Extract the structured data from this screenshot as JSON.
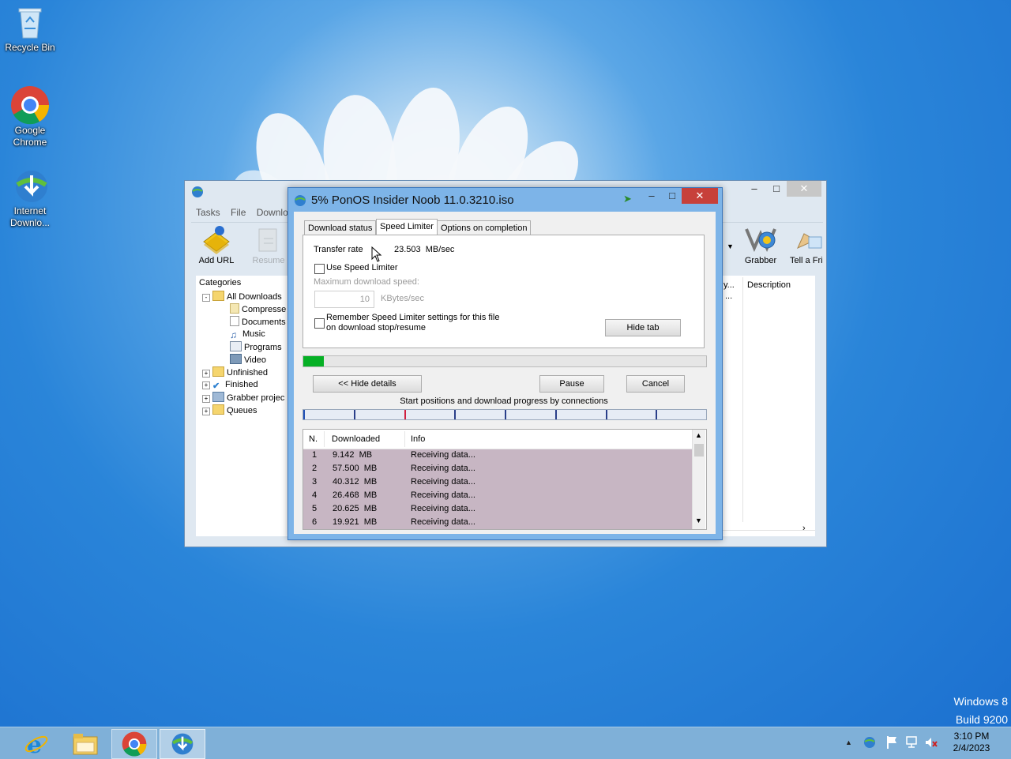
{
  "desktop": {
    "icons": [
      {
        "label": "Recycle Bin",
        "icon": "recycle-bin-icon"
      },
      {
        "label": "Google Chrome",
        "icon": "chrome-icon"
      },
      {
        "label": "Internet Downlo...",
        "icon": "idm-icon"
      }
    ],
    "watermark": {
      "line1": "Windows 8",
      "line2": "Build 9200"
    }
  },
  "main_window": {
    "menu": [
      "Tasks",
      "File",
      "Downlo"
    ],
    "toolbar": {
      "add_url": "Add URL",
      "resume": "Resume",
      "grabber": "Grabber",
      "tell_a_friend": "Tell a Fri"
    },
    "categories_label": "Categories",
    "tree": [
      {
        "label": "All Downloads",
        "icon": "folder-open-icon"
      },
      {
        "label": "Compresse",
        "icon": "zip-icon"
      },
      {
        "label": "Documents",
        "icon": "document-icon"
      },
      {
        "label": "Music",
        "icon": "music-icon"
      },
      {
        "label": "Programs",
        "icon": "program-icon"
      },
      {
        "label": "Video",
        "icon": "video-icon"
      },
      {
        "label": "Unfinished",
        "icon": "folder-arrow-icon"
      },
      {
        "label": "Finished",
        "icon": "folder-check-icon"
      },
      {
        "label": "Grabber projec",
        "icon": "grabber-folder-icon"
      },
      {
        "label": "Queues",
        "icon": "folder-icon"
      }
    ],
    "list_columns": {
      "col_partial": "y...",
      "description": "Description"
    },
    "list_cell": "..."
  },
  "dialog": {
    "title": "5% PonOS Insider Noob 11.0.3210.iso",
    "tabs": [
      "Download status",
      "Speed Limiter",
      "Options on completion"
    ],
    "active_tab": "Speed Limiter",
    "transfer_rate_label": "Transfer rate",
    "transfer_rate_value": "23.503  MB/sec",
    "use_speed_limiter": "Use Speed Limiter",
    "use_speed_limiter_checked": false,
    "max_speed_label": "Maximum download speed:",
    "max_speed_value": "10",
    "max_speed_unit": "KBytes/sec",
    "remember_line1": "Remember Speed Limiter settings for this file",
    "remember_line2": "on download stop/resume",
    "remember_checked": false,
    "hide_tab": "Hide tab",
    "progress_percent": 5,
    "hide_details": "<< Hide details",
    "pause": "Pause",
    "cancel": "Cancel",
    "connections_caption": "Start positions and download progress by connections",
    "connection_positions": [
      0.0,
      0.125,
      0.25,
      0.375,
      0.5,
      0.625,
      0.75,
      0.875
    ],
    "table_headers": [
      "N.",
      "Downloaded",
      "Info"
    ],
    "connections": [
      {
        "n": "1",
        "downloaded": "9.142  MB",
        "info": "Receiving data..."
      },
      {
        "n": "2",
        "downloaded": "57.500  MB",
        "info": "Receiving data..."
      },
      {
        "n": "3",
        "downloaded": "40.312  MB",
        "info": "Receiving data..."
      },
      {
        "n": "4",
        "downloaded": "26.468  MB",
        "info": "Receiving data..."
      },
      {
        "n": "5",
        "downloaded": "20.625  MB",
        "info": "Receiving data..."
      },
      {
        "n": "6",
        "downloaded": "19.921  MB",
        "info": "Receiving data..."
      }
    ]
  },
  "taskbar": {
    "buttons": [
      "ie-icon",
      "file-explorer-icon",
      "chrome-icon",
      "idm-icon"
    ],
    "tray_icons": [
      "show-hidden-icon",
      "idm-tray-icon",
      "flag-icon",
      "network-icon",
      "volume-muted-icon"
    ],
    "time": "3:10 PM",
    "date": "2/4/2023"
  }
}
